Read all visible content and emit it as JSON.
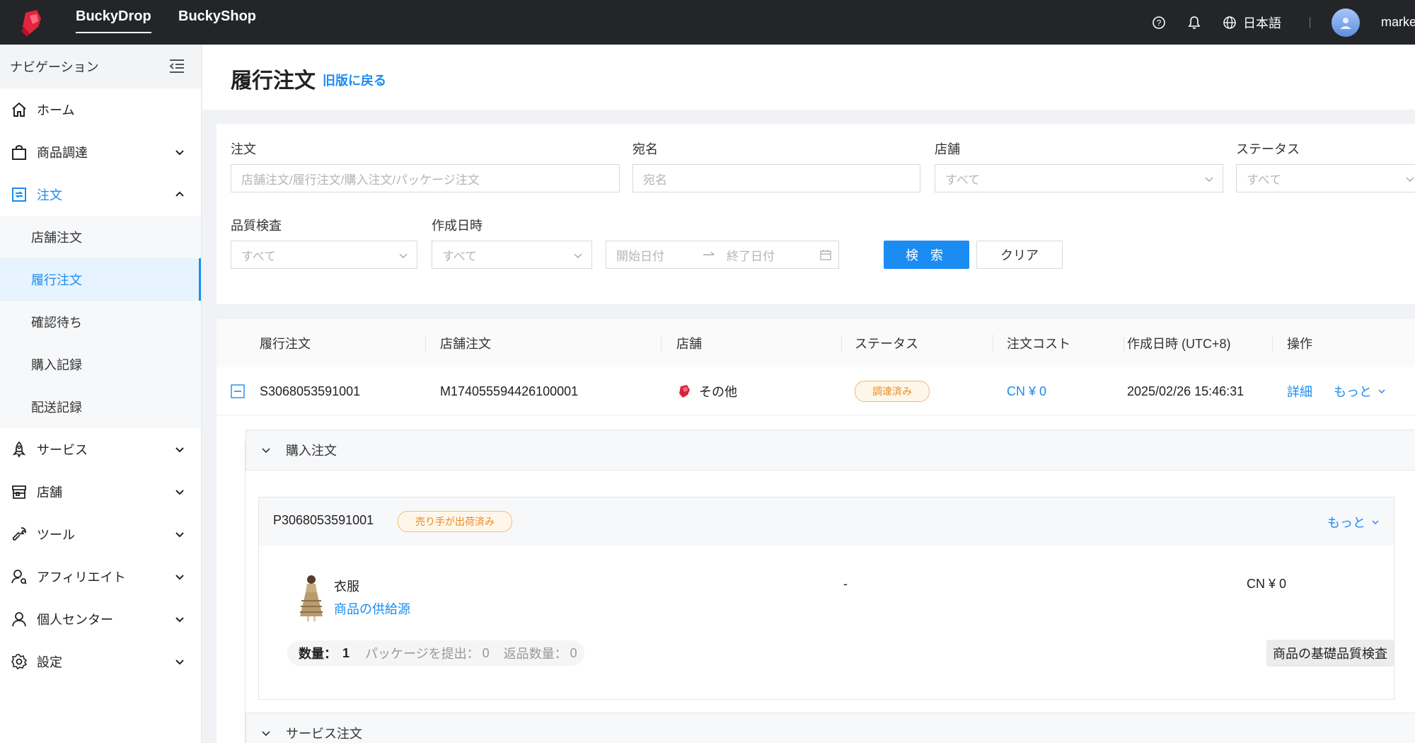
{
  "colors": {
    "accent": "#1b8cf2",
    "topbar": "#232529",
    "badge_orange": "#e98a1d"
  },
  "topbar": {
    "tabs": [
      "BuckyDrop",
      "BuckyShop"
    ],
    "language": "日本語",
    "user": "marke"
  },
  "sidebar": {
    "header": "ナビゲーション",
    "items": [
      {
        "label": "ホーム",
        "icon": "home-icon"
      },
      {
        "label": "商品調達",
        "icon": "shopping-bag-icon"
      },
      {
        "label": "注文",
        "icon": "order-icon"
      },
      {
        "label": "サービス",
        "icon": "rocket-icon"
      },
      {
        "label": "店舗",
        "icon": "store-icon"
      },
      {
        "label": "ツール",
        "icon": "wrench-icon"
      },
      {
        "label": "アフィリエイト",
        "icon": "affiliate-icon"
      },
      {
        "label": "個人センター",
        "icon": "user-icon"
      },
      {
        "label": "設定",
        "icon": "gear-icon"
      }
    ],
    "order_sub": [
      "店舗注文",
      "履行注文",
      "確認待ち",
      "購入記録",
      "配送記録"
    ]
  },
  "page": {
    "title": "履行注文",
    "back_link": "旧版に戻る"
  },
  "filters": {
    "order_label": "注文",
    "order_placeholder": "店舗注文/履行注文/購入注文/パッケージ注文",
    "recipient_label": "宛名",
    "recipient_placeholder": "宛名",
    "store_label": "店舗",
    "store_value": "すべて",
    "status_label": "ステータス",
    "status_value": "すべて",
    "qc_label": "品質検査",
    "qc_value": "すべて",
    "created_label": "作成日時",
    "created_value": "すべて",
    "start_date": "開始日付",
    "end_date": "終了日付",
    "search": "検 索",
    "clear": "クリア"
  },
  "table": {
    "headers": [
      "履行注文",
      "店舗注文",
      "店舗",
      "ステータス",
      "注文コスト",
      "作成日時 (UTC+8)",
      "操作"
    ],
    "row": {
      "fulfillment_id": "S3068053591001",
      "store_order": "M174055594426100001",
      "store": "その他",
      "status": "調達済み",
      "cost": "CN ¥ 0",
      "created": "2025/02/26 15:46:31",
      "detail": "詳細",
      "more": "もっと"
    }
  },
  "purchase": {
    "section_title": "購入注文",
    "po_id": "P3068053591001",
    "po_status": "売り手が出荷済み",
    "more": "もっと",
    "item_name": "衣服",
    "item_source": "商品の供給源",
    "item_dash": "-",
    "item_price": "CN ¥ 0",
    "qty_label": "数量：",
    "qty_value": "1",
    "pkg_label": "パッケージを提出：",
    "pkg_value": "0",
    "return_label": "返品数量：",
    "return_value": "0",
    "qc_button": "商品の基礎品質検査"
  },
  "service": {
    "section_title": "サービス注文"
  }
}
